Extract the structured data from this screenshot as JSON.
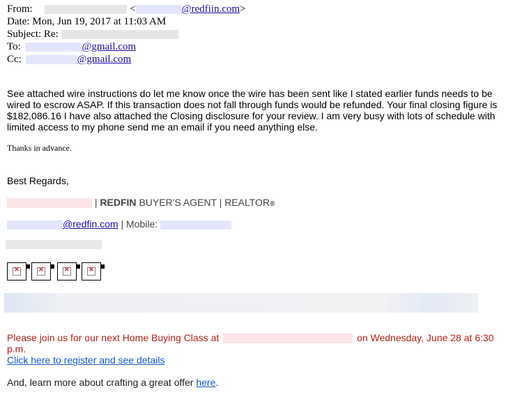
{
  "header": {
    "from_label": "From:",
    "from_lt": "<",
    "from_domain": "@redfiin.com",
    "from_gt": ">",
    "date": "Date: Mon, Jun 19, 2017 at 11:03 AM",
    "subject_label": "Subject: Re:",
    "to_label": "To:",
    "to_domain": "@gmail.com",
    "cc_label": "Cc:",
    "cc_domain": "@gmail.com"
  },
  "body": {
    "paragraph": "See attached wire instructions do let me know once the wire has been sent like I stated earlier funds needs to be wired to escrow ASAP. If this transaction does not fall through funds would be refunded. Your final closing figure is $182,086.16 I have also attached the Closing disclosure for your review. I am very busy with lots of schedule with limited access to my phone send me an email if you need anything else.",
    "thanks": "Thanks in advance."
  },
  "signature": {
    "regards": "Best Regards,",
    "separator": "|",
    "brand": "REDFIN",
    "title": "BUYER'S AGENT | REALTOR",
    "registered": "®",
    "email_domain": "@redfin.com",
    "mobile_label": "| Mobile:"
  },
  "promo": {
    "class_text": "Please join us for our next Home Buying Class at",
    "class_date": "on Wednesday, June 28 at 6:30 p.m.",
    "register_link": "Click here to register and see details",
    "offer_text": "And, learn more about crafting a great offer",
    "offer_link": "here",
    "offer_end": "."
  },
  "colors": {
    "link": "#1a0dab",
    "promo_red": "#b8201c",
    "redaction_gray": "#e6e6e6",
    "redaction_blue": "#e3e6fb",
    "redaction_pink": "#fbe5e7"
  },
  "icons": [
    "broken-image-icon",
    "broken-image-icon",
    "broken-image-icon",
    "broken-image-icon"
  ]
}
